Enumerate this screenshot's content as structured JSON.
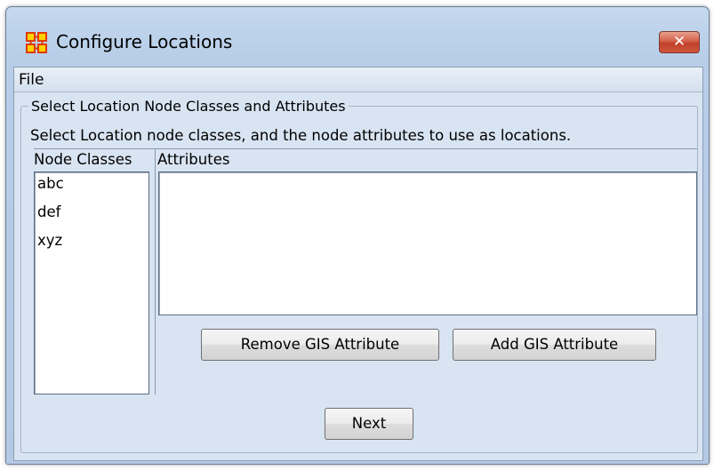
{
  "window": {
    "title": "Configure Locations",
    "close_label": "✕"
  },
  "menu": {
    "file": "File"
  },
  "group": {
    "title": "Select Location Node Classes and Attributes",
    "instructions": "Select Location node classes, and the node attributes to use as locations."
  },
  "node_classes": {
    "header": "Node Classes",
    "items": [
      "abc",
      "def",
      "xyz"
    ]
  },
  "attributes": {
    "header": "Attributes",
    "items": []
  },
  "buttons": {
    "remove": "Remove GIS Attribute",
    "add": "Add GIS Attribute",
    "next": "Next"
  },
  "colors": {
    "title_bar": "#b7cde8",
    "client_bg": "#d8e4f2",
    "close_button": "#c2402b",
    "icon_accent": "#e03a00",
    "icon_fill": "#ffd200"
  }
}
